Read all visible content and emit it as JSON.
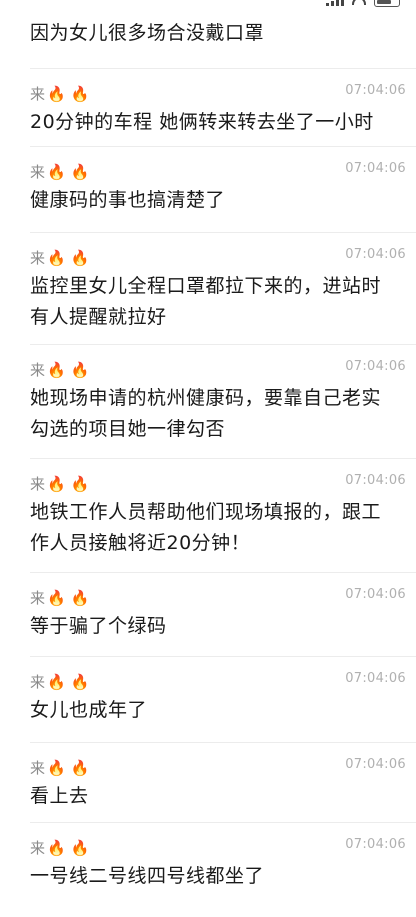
{
  "top_text": "因为女儿很多场合没戴口罩",
  "messages": [
    {
      "author": "来",
      "fire": "🔥 🔥",
      "time": "07:04:06",
      "text": "20分钟的车程 她俩转来转去坐了一小时"
    },
    {
      "author": "来",
      "fire": "🔥 🔥",
      "time": "07:04:06",
      "text": "健康码的事也搞清楚了"
    },
    {
      "author": "来",
      "fire": "🔥 🔥",
      "time": "07:04:06",
      "text": "监控里女儿全程口罩都拉下来的，进站时\n有人提醒就拉好"
    },
    {
      "author": "来",
      "fire": "🔥 🔥",
      "time": "07:04:06",
      "text": "她现场申请的杭州健康码，要靠自己老实\n勾选的项目她一律勾否"
    },
    {
      "author": "来",
      "fire": "🔥 🔥",
      "time": "07:04:06",
      "text": "地铁工作人员帮助他们现场填报的，跟工\n作人员接触将近20分钟！"
    },
    {
      "author": "来",
      "fire": "🔥 🔥",
      "time": "07:04:06",
      "text": "等于骗了个绿码"
    },
    {
      "author": "来",
      "fire": "🔥 🔥",
      "time": "07:04:06",
      "text": "女儿也成年了"
    },
    {
      "author": "来",
      "fire": "🔥 🔥",
      "time": "07:04:06",
      "text": "看上去"
    },
    {
      "author": "来",
      "fire": "🔥 🔥",
      "time": "07:04:06",
      "text": "一号线二号线四号线都坐了"
    }
  ]
}
